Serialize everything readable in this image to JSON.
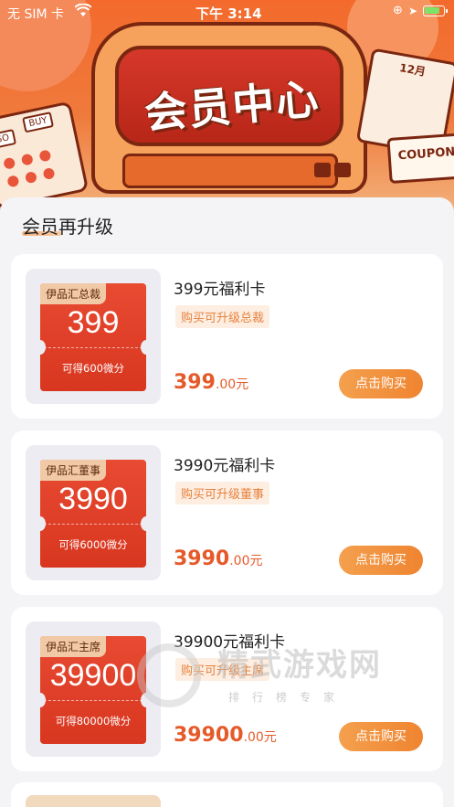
{
  "status_bar": {
    "carrier": "无 SIM 卡",
    "time": "下午 3:14"
  },
  "banner": {
    "title": "会员中心",
    "calc_go": "GO",
    "calc_buy": "BUY",
    "calendar_month": "12月",
    "coupon_text": "COUPONS"
  },
  "section": {
    "title": "会员再升级"
  },
  "cards": [
    {
      "ticket_tag": "伊品汇总裁",
      "ticket_amount": "399",
      "ticket_sub": "可得600微分",
      "name": "399元福利卡",
      "badge": "购买可升级总裁",
      "price_int": "399",
      "price_rest": ".00元",
      "button": "点击购买"
    },
    {
      "ticket_tag": "伊品汇董事",
      "ticket_amount": "3990",
      "ticket_sub": "可得6000微分",
      "name": "3990元福利卡",
      "badge": "购买可升级董事",
      "price_int": "3990",
      "price_rest": ".00元",
      "button": "点击购买"
    },
    {
      "ticket_tag": "伊品汇主席",
      "ticket_amount": "39900",
      "ticket_sub": "可得80000微分",
      "name": "39900元福利卡",
      "badge": "购买可升级主席",
      "price_int": "39900",
      "price_rest": ".00元",
      "button": "点击购买"
    }
  ],
  "watermark": {
    "title": "精武游戏网",
    "subtitle": "排行榜专家"
  }
}
